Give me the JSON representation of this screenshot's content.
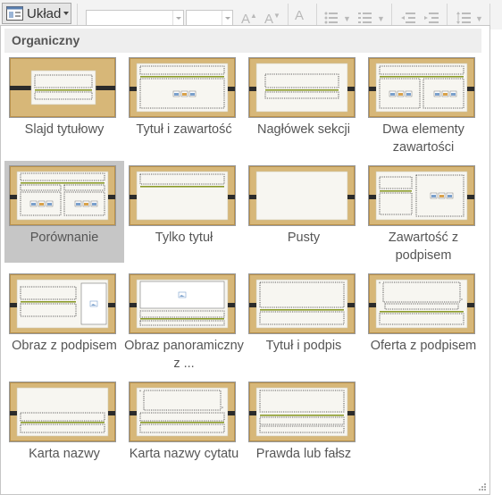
{
  "ribbon": {
    "layout_button_label": "Układ",
    "layout_icon": "layout-icon",
    "font_name_value": "",
    "font_size_value": ""
  },
  "gallery": {
    "section_title": "Organiczny",
    "selected_index": 4,
    "layouts": [
      {
        "label": "Slajd tytułowy",
        "kind": "title"
      },
      {
        "label": "Tytuł i zawartość",
        "kind": "title-content"
      },
      {
        "label": "Nagłówek sekcji",
        "kind": "section"
      },
      {
        "label": "Dwa elementy zawartości",
        "kind": "two-content"
      },
      {
        "label": "Porównanie",
        "kind": "comparison"
      },
      {
        "label": "Tylko tytuł",
        "kind": "title-only"
      },
      {
        "label": "Pusty",
        "kind": "blank"
      },
      {
        "label": "Zawartość z podpisem",
        "kind": "content-caption"
      },
      {
        "label": "Obraz z podpisem",
        "kind": "picture-caption"
      },
      {
        "label": "Obraz panoramiczny z ...",
        "kind": "panorama"
      },
      {
        "label": "Tytuł i podpis",
        "kind": "title-caption"
      },
      {
        "label": "Oferta z podpisem",
        "kind": "quote-caption"
      },
      {
        "label": "Karta nazwy",
        "kind": "name-card"
      },
      {
        "label": "Karta nazwy cytatu",
        "kind": "quote-name-card"
      },
      {
        "label": "Prawda lub fałsz",
        "kind": "true-false"
      }
    ]
  },
  "colors": {
    "wood": "#d7b778",
    "wood_dark": "#b8914c",
    "paper": "#f7f6f1",
    "bar": "#2b2b2b",
    "accent_line": "#8a9b2a",
    "selection": "#c6c6c6"
  }
}
